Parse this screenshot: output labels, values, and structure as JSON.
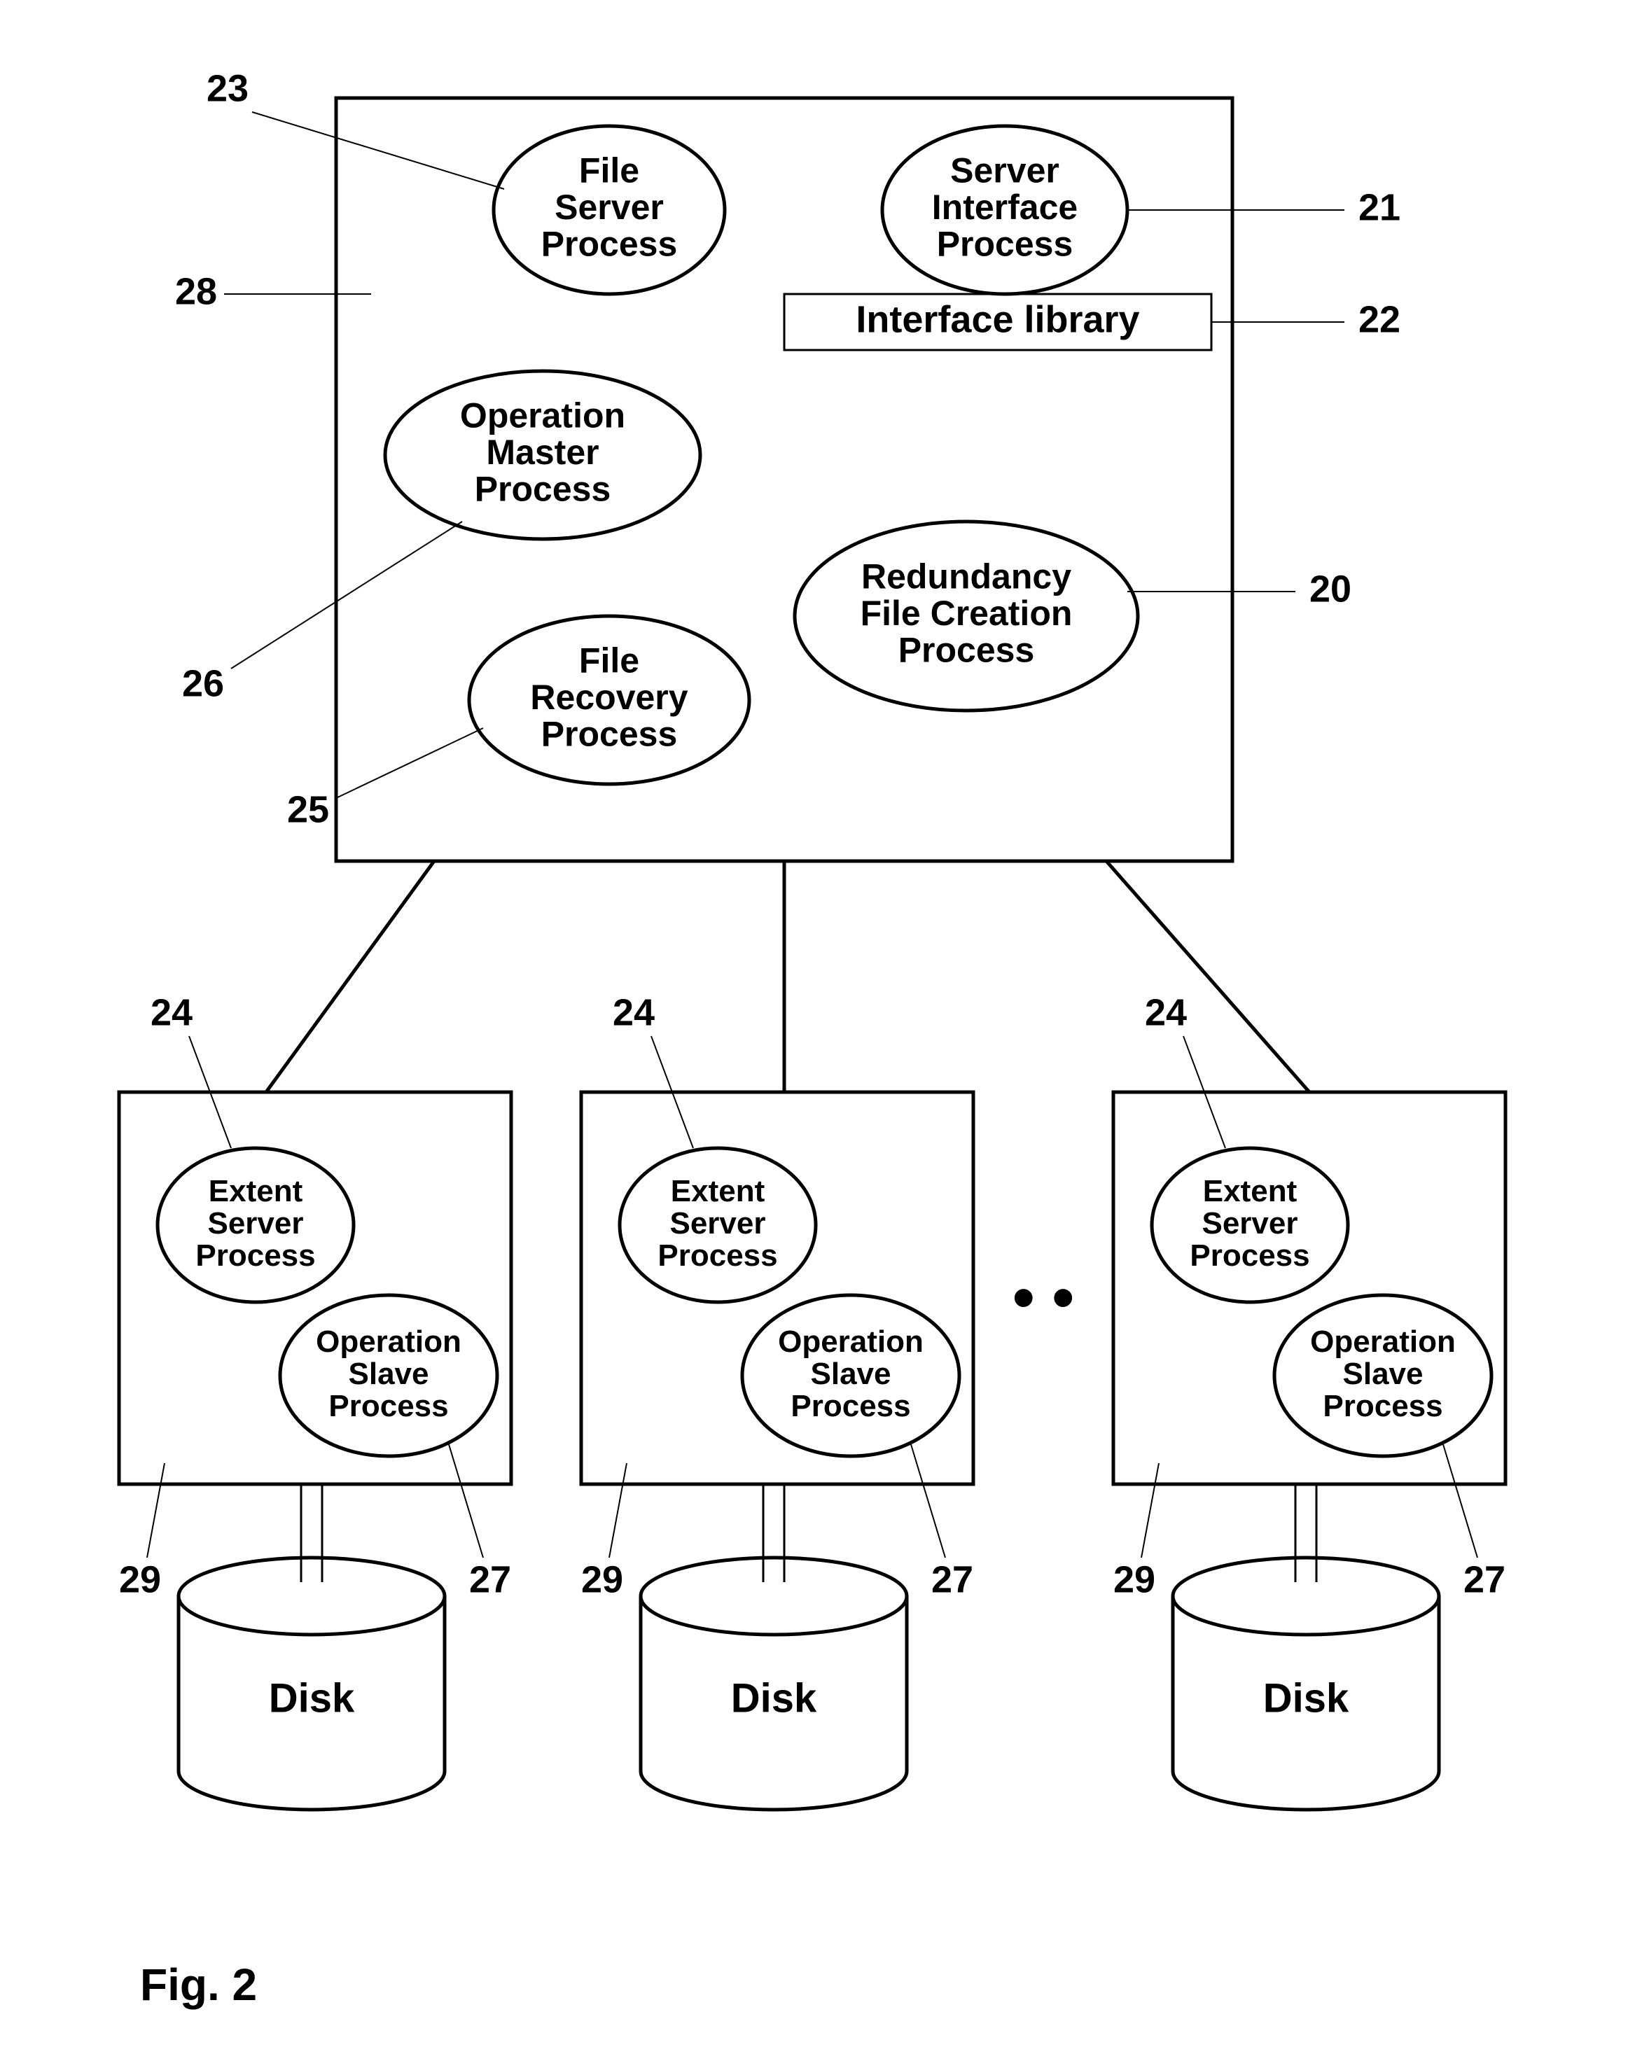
{
  "figure_label": "Fig. 2",
  "master": {
    "file_server_process": "File\nServer\nProcess",
    "server_interface_process": "Server\nInterface\nProcess",
    "interface_library": "Interface library",
    "operation_master_process": "Operation\nMaster\nProcess",
    "redundancy_file_creation_process": "Redundancy\nFile Creation\nProcess",
    "file_recovery_process": "File\nRecovery\nProcess"
  },
  "slave_node_template": {
    "extent_server_process": "Extent\nServer\nProcess",
    "operation_slave_process": "Operation\nSlave\nProcess",
    "disk": "Disk"
  },
  "ref_labels": {
    "20": "20",
    "21": "21",
    "22": "22",
    "23": "23",
    "24": "24",
    "25": "25",
    "26": "26",
    "27": "27",
    "28": "28",
    "29": "29"
  },
  "ellipsis": "• •"
}
